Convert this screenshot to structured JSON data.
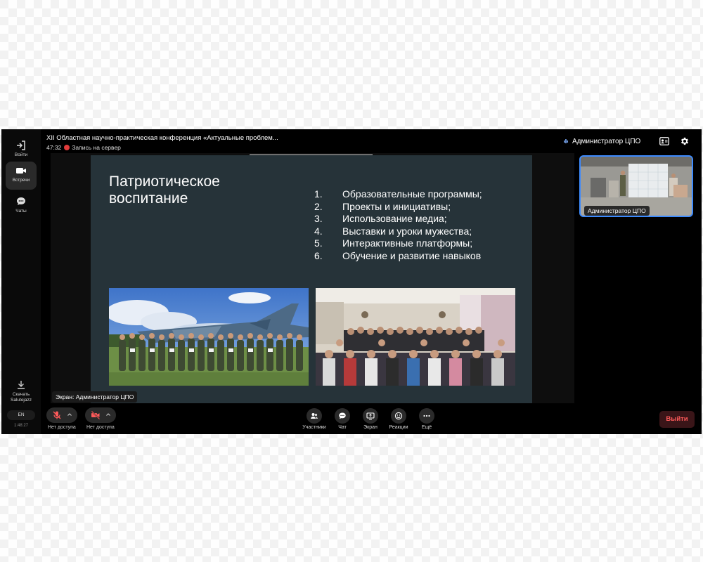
{
  "rail": {
    "items": [
      {
        "label": "Войти",
        "icon": "login-icon"
      },
      {
        "label": "Встречи",
        "icon": "camera-icon"
      },
      {
        "label": "Чаты",
        "icon": "chat-icon"
      }
    ],
    "download_label": "Скачать Salutejazz",
    "lang": "EN",
    "time": "1:48:27"
  },
  "header": {
    "title": "XII Областная научно-практическая конференция «Актуальные проблем...",
    "timer": "47:32",
    "recording_label": "Запись на сервер",
    "speaker_name": "Администратор ЦПО"
  },
  "slide": {
    "title": "Патриотическое воспитание",
    "items": [
      {
        "num": "1.",
        "text": "Образовательные программы;"
      },
      {
        "num": "2.",
        "text": "Проекты и инициативы;"
      },
      {
        "num": "3.",
        "text": "Использование медиа;"
      },
      {
        "num": "4.",
        "text": "Выставки и уроки мужества;"
      },
      {
        "num": "5.",
        "text": "Интерактивные платформы;"
      },
      {
        "num": "6.",
        "text": "Обучение и развитие навыков"
      }
    ]
  },
  "self_tile": {
    "label": "Администратор ЦПО"
  },
  "screen_label": "Экран: Администратор ЦПО",
  "controls": {
    "mic": {
      "label": "Нет доступа"
    },
    "camera": {
      "label": "Нет доступа"
    },
    "tools": [
      {
        "label": "Участники",
        "icon": "participants-icon"
      },
      {
        "label": "Чат",
        "icon": "chat-bubble-icon"
      },
      {
        "label": "Экран",
        "icon": "screen-share-icon"
      },
      {
        "label": "Реакции",
        "icon": "smiley-icon"
      },
      {
        "label": "Ещё",
        "icon": "more-icon"
      }
    ],
    "leave_label": "Выйти"
  },
  "colors": {
    "accent": "#3d8bff",
    "record": "#e23b3b",
    "leave": "#ff5a5a",
    "slide_bg": "#263339"
  }
}
